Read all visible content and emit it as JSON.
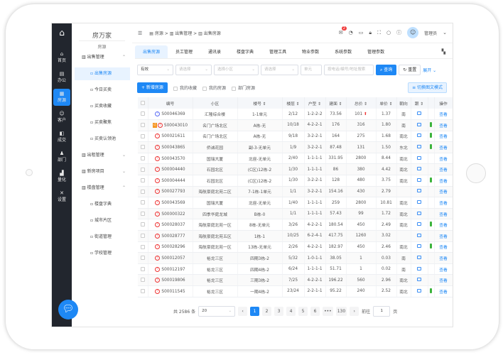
{
  "nav": {
    "items": [
      {
        "label": "首页",
        "icon": "home-icon",
        "glyph": "⌂"
      },
      {
        "label": "办公",
        "icon": "office-icon",
        "glyph": "▤"
      },
      {
        "label": "房源",
        "icon": "building-icon",
        "glyph": "▦",
        "active": true
      },
      {
        "label": "客户",
        "icon": "customer-icon",
        "glyph": "☺"
      },
      {
        "label": "成交",
        "icon": "deal-icon",
        "glyph": "◧"
      },
      {
        "label": "部门",
        "icon": "department-icon",
        "glyph": "♟"
      },
      {
        "label": "量化",
        "icon": "chart-icon",
        "glyph": "▟"
      },
      {
        "label": "设置",
        "icon": "settings-icon",
        "glyph": "✕"
      }
    ]
  },
  "sidebar": {
    "title": "房万家",
    "subtitle": "房源",
    "items": [
      {
        "label": "出售管理",
        "level": 1,
        "chev": "⌃"
      },
      {
        "label": "出售房源",
        "level": 2,
        "active": true
      },
      {
        "label": "今日买卖",
        "level": 2
      },
      {
        "label": "买卖收藏",
        "level": 2
      },
      {
        "label": "买卖聚焦",
        "level": 2
      },
      {
        "label": "买卖认领池",
        "level": 2
      },
      {
        "label": "出租管理",
        "level": 1,
        "chev": "⌄"
      },
      {
        "label": "新房项目",
        "level": 1,
        "chev": "⌄"
      },
      {
        "label": "楼盘管理",
        "level": 1,
        "chev": "⌃"
      },
      {
        "label": "楼盘字典",
        "level": 2
      },
      {
        "label": "城市片区",
        "level": 2
      },
      {
        "label": "街道管理",
        "level": 2
      },
      {
        "label": "学校管理",
        "level": 2
      }
    ]
  },
  "header": {
    "breadcrumb": "▤ 房源  >  ▥ 出售管理  >  ▥ 出售房源",
    "notif_count": "2",
    "user": "管理员"
  },
  "tabs": [
    "出售房源",
    "员工管理",
    "通讯录",
    "楼盘字典",
    "管理工具",
    "物业参数",
    "系统参数",
    "管理参数"
  ],
  "filters": {
    "status": "有效",
    "select1": "请选择",
    "community": "选择小区",
    "select2": "请选择",
    "unit": "单元",
    "search_placeholder": "按电话/编号/地址搜索",
    "query": "查询",
    "reset": "重置",
    "expand": "展开"
  },
  "toolbar": {
    "add": "+ 新增房源",
    "fav": "我的收藏",
    "mine": "我的房源",
    "dept": "部门房源",
    "switch": "≡ 切换图文模式"
  },
  "table": {
    "headers": [
      "编号",
      "小区",
      "楼号 ⇕",
      "楼层 ⇕",
      "户型 ⇕",
      "建面 ⇕",
      "总价 ⇕",
      "单价 ⇕",
      "朝向",
      "跟 ⇕",
      "",
      "操作"
    ],
    "action": "查看",
    "rows": [
      [
        "S00046369",
        "汇隆综合楼",
        "1-1单元",
        "2/12",
        "1-2-2-2",
        "73.56",
        "101",
        "1.37",
        "南"
      ],
      [
        "S00043010",
        "名门广场北区",
        "A栋-无",
        "10/18",
        "4-2-2-1",
        "176",
        "316",
        "1.80",
        "南"
      ],
      [
        "S00021611",
        "名门广场北区",
        "A栋-无",
        "9/18",
        "3-2-2-1",
        "164",
        "275",
        "1.68",
        "南北"
      ],
      [
        "S00043865",
        "侨诚花园",
        "副-3-无单元",
        "1/9",
        "3-2-2-1",
        "87.48",
        "131",
        "1.50",
        "东北"
      ],
      [
        "S00043570",
        "国瑞大厦",
        "北座-无单元",
        "2/40",
        "1-1-1-1",
        "331.95",
        "2800",
        "8.44",
        "南北"
      ],
      [
        "S00004440",
        "石园北区",
        "(C区)12栋-2",
        "1/30",
        "1-1-1-1",
        "86",
        "380",
        "4.42",
        "南北"
      ],
      [
        "S00004444",
        "石园北区",
        "(C区)12栋-2",
        "1/30",
        "3-2-2-1",
        "128",
        "480",
        "3.75",
        "南北"
      ],
      [
        "S00027793",
        "海航豪庭北苑二区",
        "7-1栋-1单元",
        "1/1",
        "3-2-2-1",
        "154.16",
        "430",
        "2.79",
        ""
      ],
      [
        "S00043569",
        "国瑞大厦",
        "北座-无单元",
        "1/40",
        "1-1-1-1",
        "259",
        "2800",
        "10.81",
        "南北"
      ],
      [
        "S00000322",
        "四季华庭龙城",
        "B栋-0",
        "1/1",
        "1-1-1-1",
        "57.43",
        "99",
        "1.72",
        "南北"
      ],
      [
        "S00028037",
        "海航豪庭北苑一区",
        "8栋-无单元",
        "3/26",
        "4-2-2-1",
        "180.54",
        "450",
        "2.49",
        "南北"
      ],
      [
        "S00028777",
        "海航豪庭北苑五区",
        "1栋-1",
        "10/25",
        "6-2-4-1",
        "417.75",
        "1260",
        "3.02",
        ""
      ],
      [
        "S00028296",
        "海航豪庭北苑一区",
        "13栋-无单元",
        "2/26",
        "4-2-2-1",
        "182.97",
        "450",
        "2.46",
        "南北"
      ],
      [
        "S00012057",
        "裕龙三区",
        "四期3栋-2",
        "5/32",
        "1-0-1-1",
        "38.05",
        "1",
        "0.03",
        "南"
      ],
      [
        "S00012197",
        "裕龙三区",
        "四期4栋-2",
        "6/24",
        "1-1-1-1",
        "51.71",
        "1",
        "0.02",
        "南"
      ],
      [
        "S00019806",
        "裕龙三区",
        "三期3栋-2",
        "7/25",
        "4-2-2-1",
        "196.22",
        "560",
        "2.96",
        "南北"
      ],
      [
        "S00011545",
        "裕龙三区",
        "一期4栋-2",
        "23/24",
        "2-2-1-1",
        "95.22",
        "240",
        "2.52",
        "南北"
      ]
    ],
    "tagged_rows": [
      1
    ],
    "blue_status_rows": [
      0
    ],
    "price_up_rows": [
      0
    ],
    "green_mark_rows": [
      1,
      2,
      3,
      6,
      10,
      12,
      16
    ]
  },
  "pagination": {
    "total": "共 2586 条",
    "page_size": "20",
    "pages": [
      "1",
      "2",
      "3",
      "4",
      "5",
      "6",
      "•••",
      "130"
    ],
    "current": "1",
    "goto_label": "前往",
    "goto_value": "1",
    "page_suffix": "页",
    "prev": "‹",
    "next": "›"
  },
  "colors": {
    "accent": "#1e88f5",
    "nav_bg": "#22262e",
    "status_red": "#e33333"
  }
}
